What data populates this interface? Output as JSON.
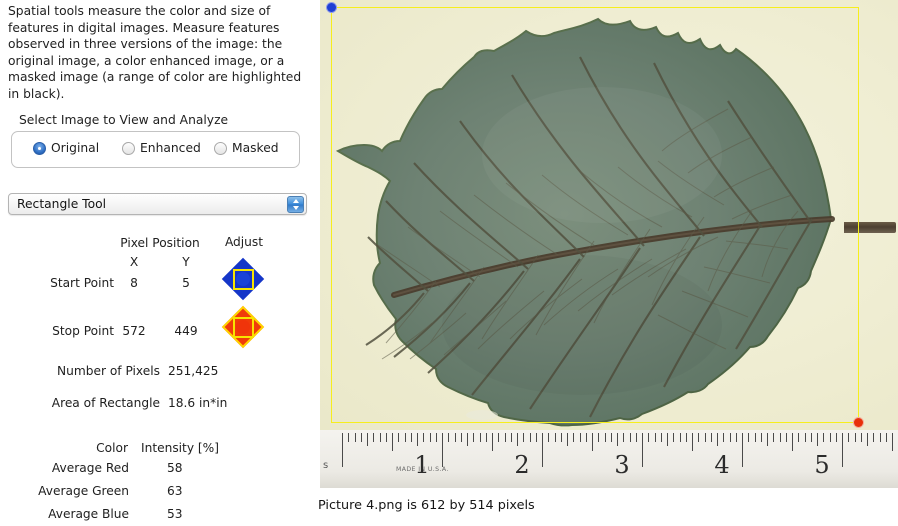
{
  "description": "Spatial tools measure the color and size of features in digital images.  Measure features observed in three versions of the image: the original image, a color enhanced image, or a masked image (a range of color are highlighted in black).",
  "image_selector": {
    "group_title": "Select Image to View and Analyze",
    "options": [
      {
        "label": "Original",
        "selected": true
      },
      {
        "label": "Enhanced",
        "selected": false
      },
      {
        "label": "Masked",
        "selected": false
      }
    ]
  },
  "tool_select": {
    "value": "Rectangle Tool",
    "arrows_icon": "up-down-stepper-icon"
  },
  "readout": {
    "headers": {
      "pixel_position": "Pixel Position",
      "adjust": "Adjust",
      "x": "X",
      "y": "Y"
    },
    "start_point": {
      "label": "Start Point",
      "x": "8",
      "y": "5",
      "adjust_icon": "blue-dpad-icon"
    },
    "stop_point": {
      "label": "Stop Point",
      "x": "572",
      "y": "449",
      "adjust_icon": "red-dpad-icon"
    },
    "number_of_pixels": {
      "label": "Number of Pixels",
      "value": "251,425"
    },
    "area_of_rectangle": {
      "label": "Area of Rectangle",
      "value": "18.6 in*in"
    },
    "color_header": {
      "color": "Color",
      "intensity": "Intensity [%]"
    },
    "averages": [
      {
        "label": "Average Red",
        "value": "58"
      },
      {
        "label": "Average Green",
        "value": "63"
      },
      {
        "label": "Average Blue",
        "value": "53"
      }
    ]
  },
  "image_view": {
    "caption": "Picture 4.png is 612 by 514 pixels",
    "subject": "green leaf photograph on cream background",
    "ruler": {
      "numbers": [
        "1",
        "2",
        "3",
        "4",
        "5"
      ],
      "made_in": "MADE IN U.S.A.",
      "edge_label": "s"
    },
    "selection": {
      "start_handle": "start-point-handle",
      "stop_handle": "stop-point-handle",
      "border_color": "#f6ee1c",
      "start_color": "#1f3fd4",
      "stop_color": "#e8300a"
    }
  }
}
